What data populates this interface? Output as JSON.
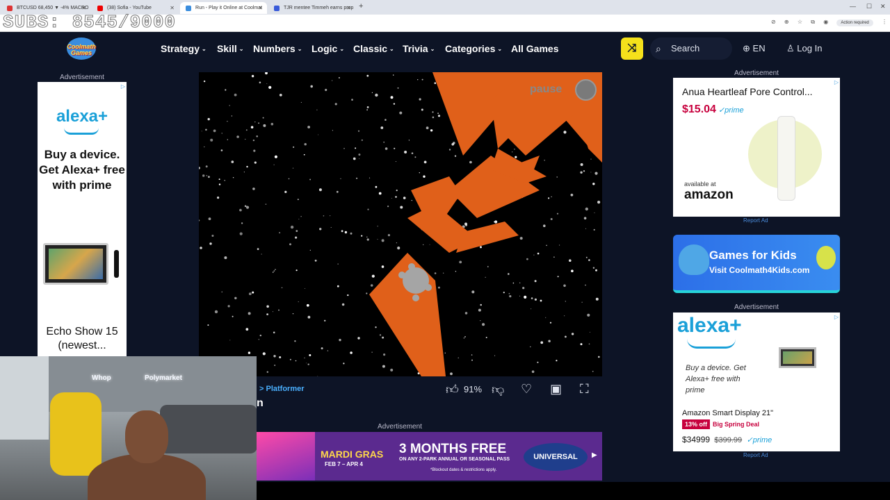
{
  "browser": {
    "tabs": [
      {
        "label": "BTCUSD 68,450 ▼ -4% MACRO",
        "fav": "#d33"
      },
      {
        "label": "(38) Sofia - YouTube",
        "fav": "#e00"
      },
      {
        "label": "Run - Play it Online at Coolmat",
        "fav": "#3a8dde"
      },
      {
        "label": "TJR mentee Timmeh earns prop",
        "fav": "#3a5bd9"
      }
    ],
    "new_tab": "+",
    "action_required": "Action required",
    "overlay": "SUBS: 8545/9000",
    "window_controls": [
      "—",
      "☐",
      "✕"
    ]
  },
  "site": {
    "logo": "Coolmath Games",
    "nav": [
      "Strategy",
      "Skill",
      "Numbers",
      "Logic",
      "Classic",
      "Trivia",
      "Categories"
    ],
    "all_games": "All Games",
    "search_label": "Search",
    "language": "EN",
    "login": "Log In"
  },
  "ads": {
    "label": "Advertisement",
    "report": "Report Ad",
    "left": {
      "brand": "alexa+",
      "headline": "Buy a device. Get Alexa+ free with prime",
      "product": "Echo Show 15 (newest..."
    },
    "bottom": {
      "event": "MARDI GRAS",
      "dates": "FEB 7 – APR 4",
      "offer": "3 MONTHS FREE",
      "offer_detail": "ON ANY 2-PARK ANNUAL OR SEASONAL PASS",
      "fine_print": "*Blockout dates & restrictions apply.",
      "brand": "UNIVERSAL"
    },
    "right1": {
      "title": "Anua Heartleaf Pore Control...",
      "price": "$15.04",
      "prime": "✓prime",
      "available": "available at",
      "store": "amazon"
    },
    "kids": {
      "title": "Games for Kids",
      "subtitle": "Visit Coolmath4Kids.com"
    },
    "right2": {
      "brand": "alexa+",
      "headline": "Buy a device. Get Alexa+ free with prime",
      "product": "Amazon Smart Display 21\"",
      "discount": "13% off",
      "deal": "Big Spring Deal",
      "price": "$34999",
      "list_price": "$399.99",
      "prime": "✓prime"
    }
  },
  "game": {
    "pause_label": "pause",
    "breadcrumb": "> Platformer",
    "title_fragment": "n",
    "rating": "91%"
  },
  "stream": {
    "sponsor1": "Whop",
    "sponsor2": "Polymarket"
  },
  "colors": {
    "page_bg": "#0d1426",
    "accent_yellow": "#f5e11b",
    "game_orange": "#e0601a",
    "link_blue": "#4ab0ff"
  }
}
